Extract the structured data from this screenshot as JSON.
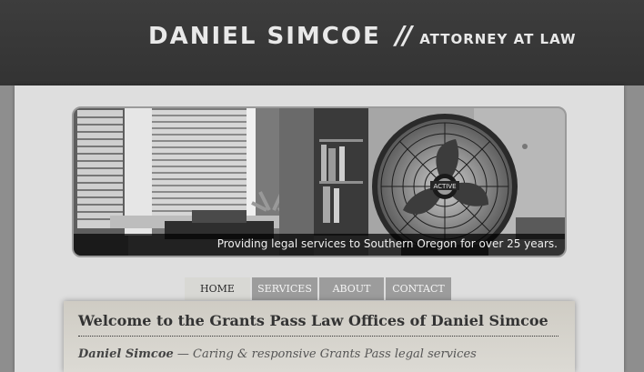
{
  "header": {
    "name": "DANIEL SIMCOE",
    "separator": "//",
    "tagline": "ATTORNEY AT LAW"
  },
  "banner": {
    "caption": "Providing legal services to Southern Oregon for over 25 years.",
    "fan_label": "ACTIVE"
  },
  "nav": {
    "tabs": [
      {
        "label": "HOME",
        "active": true
      },
      {
        "label": "SERVICES",
        "active": false
      },
      {
        "label": "ABOUT",
        "active": false
      },
      {
        "label": "CONTACT",
        "active": false
      }
    ]
  },
  "content": {
    "welcome": "Welcome to the Grants Pass Law Offices of Daniel Simcoe",
    "sub_name": "Daniel Simcoe",
    "sub_text": "— Caring & responsive Grants Pass legal services"
  }
}
